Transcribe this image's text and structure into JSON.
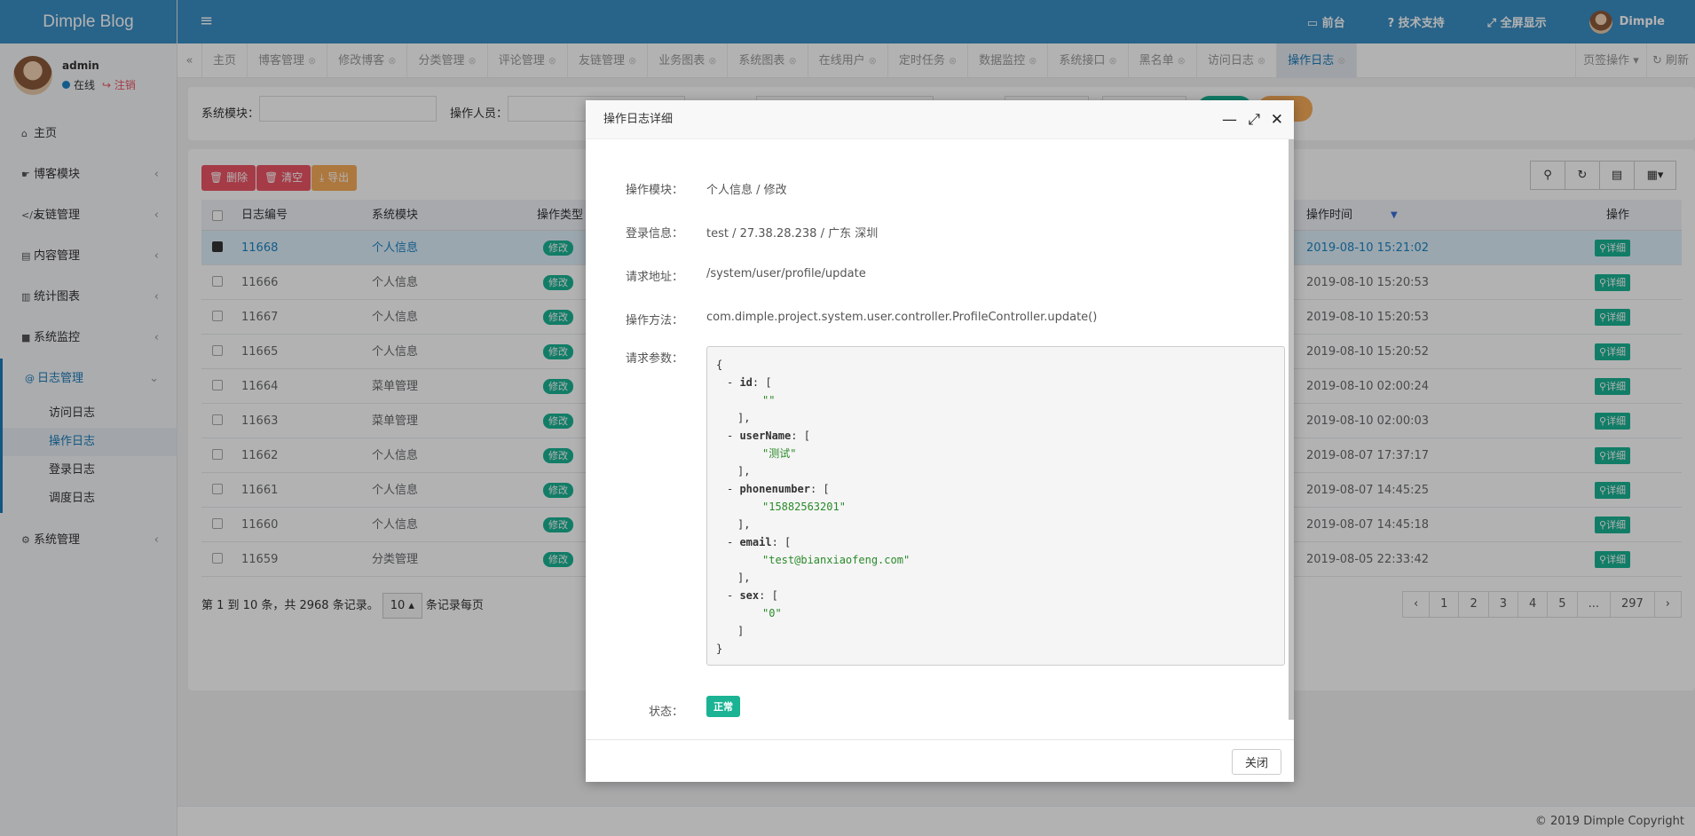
{
  "app": {
    "title": "Dimple Blog",
    "menu_icon": "hamburger-icon"
  },
  "sidebar": {
    "username": "admin",
    "status": "在线",
    "logout": "注销",
    "items": [
      {
        "label": "主页",
        "icon": "home-icon"
      },
      {
        "label": "博客模块",
        "icon": "hand-icon"
      },
      {
        "label": "友链管理",
        "icon": "code-icon"
      },
      {
        "label": "内容管理",
        "icon": "table-icon"
      },
      {
        "label": "统计图表",
        "icon": "bar-chart-icon"
      },
      {
        "label": "系统监控",
        "icon": "video-icon"
      },
      {
        "label": "日志管理",
        "icon": "at-icon"
      }
    ],
    "sub": [
      "访问日志",
      "操作日志",
      "登录日志",
      "调度日志"
    ],
    "last": {
      "label": "系统管理",
      "icon": "gear-icon"
    }
  },
  "topbar": {
    "front": "前台",
    "support": "技术支持",
    "fullscreen": "全屏显示",
    "user": "Dimple"
  },
  "tabs": [
    "主页",
    "博客管理",
    "修改博客",
    "分类管理",
    "评论管理",
    "友链管理",
    "业务图表",
    "系统图表",
    "在线用户",
    "定时任务",
    "数据监控",
    "系统接口",
    "黑名单",
    "访问日志",
    "操作日志"
  ],
  "tab_ops": "页签操作",
  "tab_refresh": "刷新",
  "search": {
    "module_label": "系统模块：",
    "operator_label": "操作人员："
  },
  "toolbar": {
    "delete": "删除",
    "clear": "清空",
    "export": "导出"
  },
  "table": {
    "headers": [
      "日志编号",
      "系统模块",
      "操作类型",
      "操作时间",
      "操作"
    ],
    "rows": [
      {
        "id": "11668",
        "module": "个人信息",
        "type": "修改",
        "time": "2019-08-10 15:21:02",
        "action": "详细",
        "selected": true
      },
      {
        "id": "11666",
        "module": "个人信息",
        "type": "修改",
        "time": "2019-08-10 15:20:53",
        "action": "详细"
      },
      {
        "id": "11667",
        "module": "个人信息",
        "type": "修改",
        "time": "2019-08-10 15:20:53",
        "action": "详细"
      },
      {
        "id": "11665",
        "module": "个人信息",
        "type": "修改",
        "time": "2019-08-10 15:20:52",
        "action": "详细"
      },
      {
        "id": "11664",
        "module": "菜单管理",
        "type": "修改",
        "time": "2019-08-10 02:00:24",
        "action": "详细"
      },
      {
        "id": "11663",
        "module": "菜单管理",
        "type": "修改",
        "time": "2019-08-10 02:00:03",
        "action": "详细"
      },
      {
        "id": "11662",
        "module": "个人信息",
        "type": "修改",
        "time": "2019-08-07 17:37:17",
        "action": "详细"
      },
      {
        "id": "11661",
        "module": "个人信息",
        "type": "修改",
        "time": "2019-08-07 14:45:25",
        "action": "详细"
      },
      {
        "id": "11660",
        "module": "个人信息",
        "type": "修改",
        "time": "2019-08-07 14:45:18",
        "action": "详细"
      },
      {
        "id": "11659",
        "module": "分类管理",
        "type": "修改",
        "time": "2019-08-05 22:33:42",
        "action": "详细"
      }
    ]
  },
  "pagination": {
    "info_pre": "第 1 到 10 条，共 2968 条记录。",
    "size": "10",
    "info_post": "条记录每页",
    "pages": [
      "‹",
      "1",
      "2",
      "3",
      "4",
      "5",
      "...",
      "297",
      "›"
    ]
  },
  "footer": "© 2019 Dimple Copyright",
  "modal": {
    "title": "操作日志详细",
    "fields": [
      {
        "label": "操作模块：",
        "value": "个人信息 / 修改"
      },
      {
        "label": "登录信息：",
        "value": "test / 27.38.28.238 / 广东 深圳"
      },
      {
        "label": "请求地址：",
        "value": "/system/user/profile/update"
      },
      {
        "label": "操作方法：",
        "value": "com.dimple.project.system.user.controller.ProfileController.update()"
      }
    ],
    "params_label": "请求参数：",
    "json": {
      "open": "{",
      "close": "}",
      "entries": [
        {
          "key": "id",
          "value": "\"\""
        },
        {
          "key": "userName",
          "value": "\"测试\""
        },
        {
          "key": "phonenumber",
          "value": "\"15882563201\""
        },
        {
          "key": "email",
          "value": "\"test@bianxiaofeng.com\""
        },
        {
          "key": "sex",
          "value": "\"0\""
        }
      ]
    },
    "status_label": "状态：",
    "status": "正常",
    "close": "关闭"
  }
}
